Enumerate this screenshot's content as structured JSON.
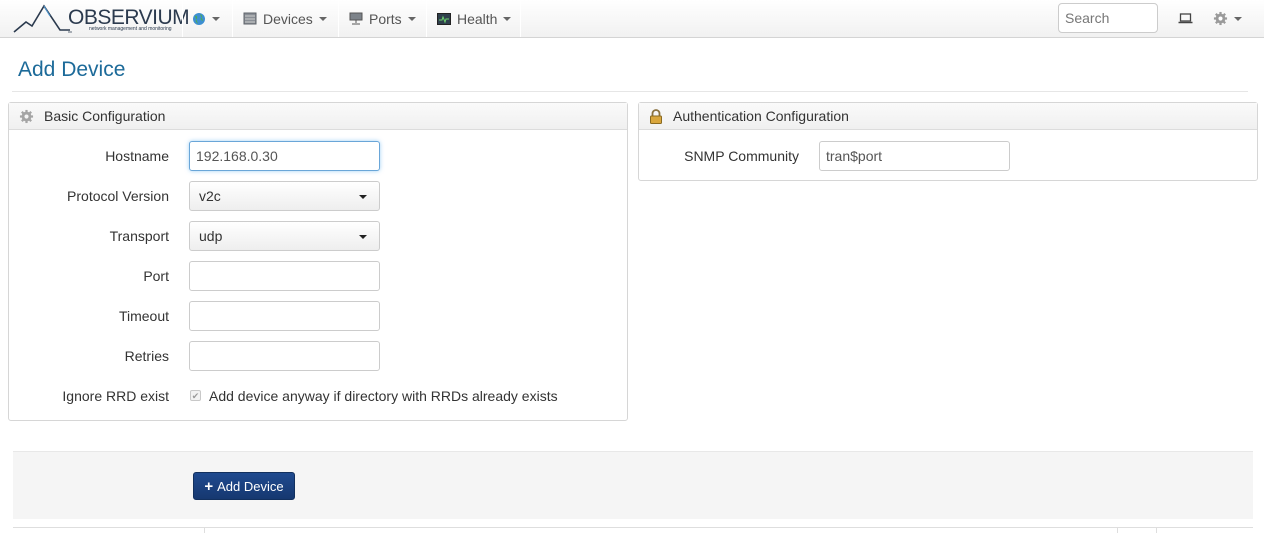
{
  "navbar": {
    "brand_name": "OBSERVIUM",
    "brand_tagline": "network management and monitoring",
    "menus": [
      {
        "label": "Devices"
      },
      {
        "label": "Ports"
      },
      {
        "label": "Health"
      }
    ],
    "search": {
      "placeholder": "Search",
      "value": ""
    }
  },
  "page": {
    "title": "Add Device"
  },
  "basic": {
    "heading": "Basic Configuration",
    "hostname": {
      "label": "Hostname",
      "value": "192.168.0.30"
    },
    "protocol": {
      "label": "Protocol Version",
      "value": "v2c"
    },
    "transport": {
      "label": "Transport",
      "value": "udp"
    },
    "port": {
      "label": "Port",
      "value": ""
    },
    "timeout": {
      "label": "Timeout",
      "value": ""
    },
    "retries": {
      "label": "Retries",
      "value": ""
    },
    "ignore_rrd": {
      "label": "Ignore RRD exist",
      "checked": true,
      "text": "Add device anyway if directory with RRDs already exists"
    }
  },
  "auth": {
    "heading": "Authentication Configuration",
    "community": {
      "label": "SNMP Community",
      "value": "tran$port"
    }
  },
  "actions": {
    "add_label": "Add Device"
  },
  "colors": {
    "title": "#1c6a99",
    "primary_button": "#1f4a8f",
    "focus_border": "#6aa6d8"
  }
}
